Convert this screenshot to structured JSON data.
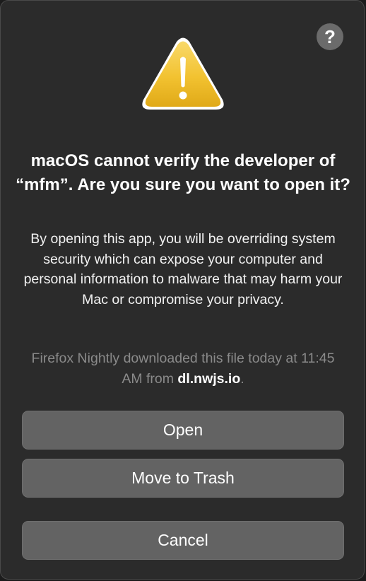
{
  "dialog": {
    "help_label": "?",
    "icon": "warning-triangle-icon",
    "title": "macOS cannot verify the developer of “mfm”. Are you sure you want to open it?",
    "message": "By opening this app, you will be overriding system security which can expose your computer and personal information to malware that may harm your Mac or compromise your privacy.",
    "source_prefix": "Firefox Nightly downloaded this file today at 11:45 AM from",
    "source_host": "dl.nwjs.io",
    "source_suffix": "."
  },
  "buttons": {
    "open": "Open",
    "move_to_trash": "Move to Trash",
    "cancel": "Cancel"
  },
  "colors": {
    "dialog_background": "#2b2b2b",
    "button_background": "#636363",
    "warning_yellow": "#f2c230",
    "secondary_text": "#8a8a8a"
  }
}
